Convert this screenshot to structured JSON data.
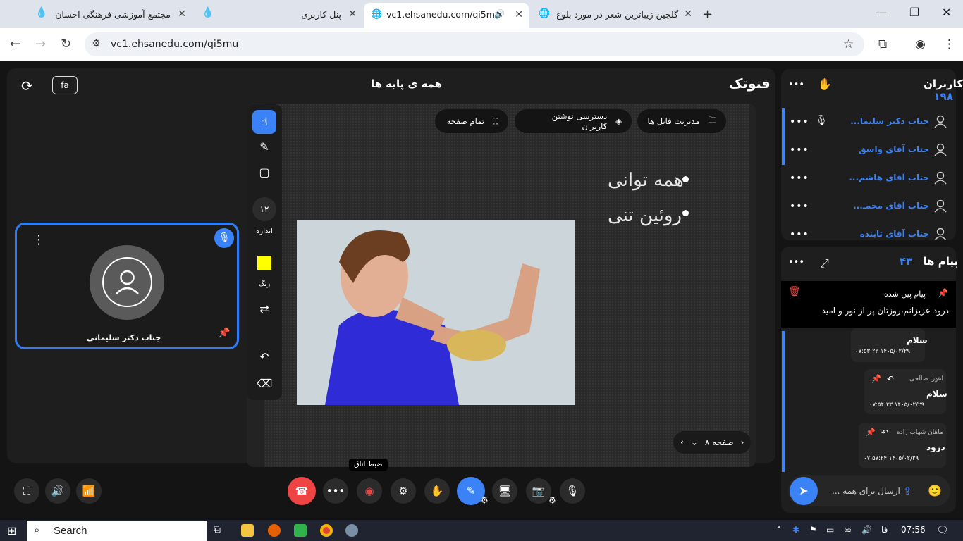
{
  "browser": {
    "tabs": [
      {
        "title": "مجتمع آموزشی فرهنگی احسان"
      },
      {
        "title": "پنل کاربری"
      },
      {
        "title": "vc1.ehsanedu.com/qi5mu"
      },
      {
        "title": "گلچین زیباترین شعر در مورد بلوغ"
      }
    ],
    "url": "vc1.ehsanedu.com/qi5mu"
  },
  "room": {
    "brand": "فنوتک",
    "title": "همه ی پایه ها",
    "lang_button": "fa",
    "camera_tile": {
      "name": "جناب دکتر سلیمانی"
    }
  },
  "whiteboard": {
    "tools": {
      "size_value": "۱۲",
      "size_label": "اندازه",
      "color_label": "رنگ",
      "color_value": "#ffff00"
    },
    "actions": {
      "file_manager": "مدیریت فایل ها",
      "user_write_access": "دسترسی نوشتن کاربران",
      "fullscreen": "تمام صفحه"
    },
    "slide_bullets": [
      "همه توانی",
      "روئین تنی"
    ],
    "pager": {
      "label": "صفحه ۸"
    }
  },
  "controls": {
    "record_tooltip": "ضبط اتاق"
  },
  "users": {
    "title": "کاربران",
    "count": "۱۹۸",
    "list": [
      {
        "name": "جناب دکتر سلیما..."
      },
      {
        "name": "جناب آقای واسق"
      },
      {
        "name": "جناب آقای هاشم..."
      },
      {
        "name": "جناب آقای محمـ..."
      },
      {
        "name": "جناب آقای تابنده"
      }
    ]
  },
  "messages": {
    "title": "پیام ها",
    "count": "۴۳",
    "pinned_label": "پیام پین شده",
    "pinned_text": "درود عزیزانم،روزتان پر از نور و امید",
    "items": [
      {
        "sender": "",
        "text": "سلام",
        "time": "۰۷:۵۳:۲۲ ۱۴۰۵/۰۲/۲۹"
      },
      {
        "sender": "اهورا صالحی",
        "text": "سلام",
        "time": "۰۷:۵۴:۳۳ ۱۴۰۵/۰۲/۲۹"
      },
      {
        "sender": "ماهان شهاب زاده",
        "text": "درود",
        "time": "۰۷:۵۷:۲۴ ۱۴۰۵/۰۲/۲۹"
      }
    ],
    "input_placeholder": "ارسال برای همه ..."
  },
  "taskbar": {
    "search_label": "Search",
    "lang": "فا",
    "clock": "07:56"
  }
}
